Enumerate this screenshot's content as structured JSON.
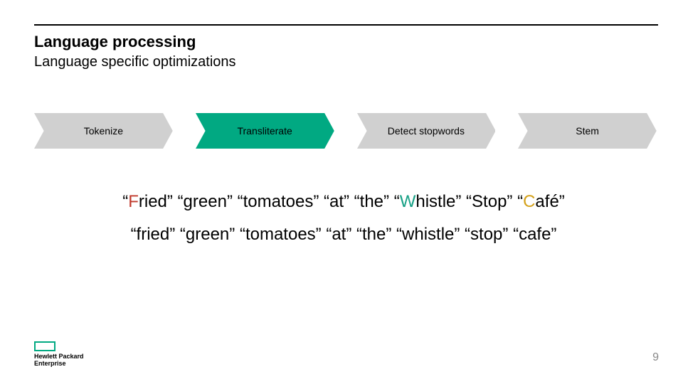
{
  "title": "Language processing",
  "subtitle": "Language specific optimizations",
  "steps": [
    {
      "label": "Tokenize",
      "active": false
    },
    {
      "label": "Transliterate",
      "active": true
    },
    {
      "label": "Detect stopwords",
      "active": false
    },
    {
      "label": "Stem",
      "active": false
    }
  ],
  "line1_tokens": [
    {
      "text": "Fried",
      "hl": "F"
    },
    {
      "text": "green",
      "hl": null
    },
    {
      "text": "tomatoes",
      "hl": null
    },
    {
      "text": "at",
      "hl": null
    },
    {
      "text": "the",
      "hl": null
    },
    {
      "text": "Whistle",
      "hl": "W"
    },
    {
      "text": "Stop",
      "hl": null
    },
    {
      "text": "Café",
      "hl": "C"
    }
  ],
  "line2_tokens": [
    {
      "text": "fried",
      "hl": null
    },
    {
      "text": "green",
      "hl": null
    },
    {
      "text": "tomatoes",
      "hl": null
    },
    {
      "text": "at",
      "hl": null
    },
    {
      "text": "the",
      "hl": null
    },
    {
      "text": "whistle",
      "hl": null
    },
    {
      "text": "stop",
      "hl": null
    },
    {
      "text": "cafe",
      "hl": null
    }
  ],
  "colors": {
    "teal": "#01a982",
    "grey": "#d0d0d0",
    "step_text_active": "#000",
    "step_text_inactive": "#000"
  },
  "logo": {
    "line1": "Hewlett Packard",
    "line2": "Enterprise"
  },
  "page_number": "9"
}
